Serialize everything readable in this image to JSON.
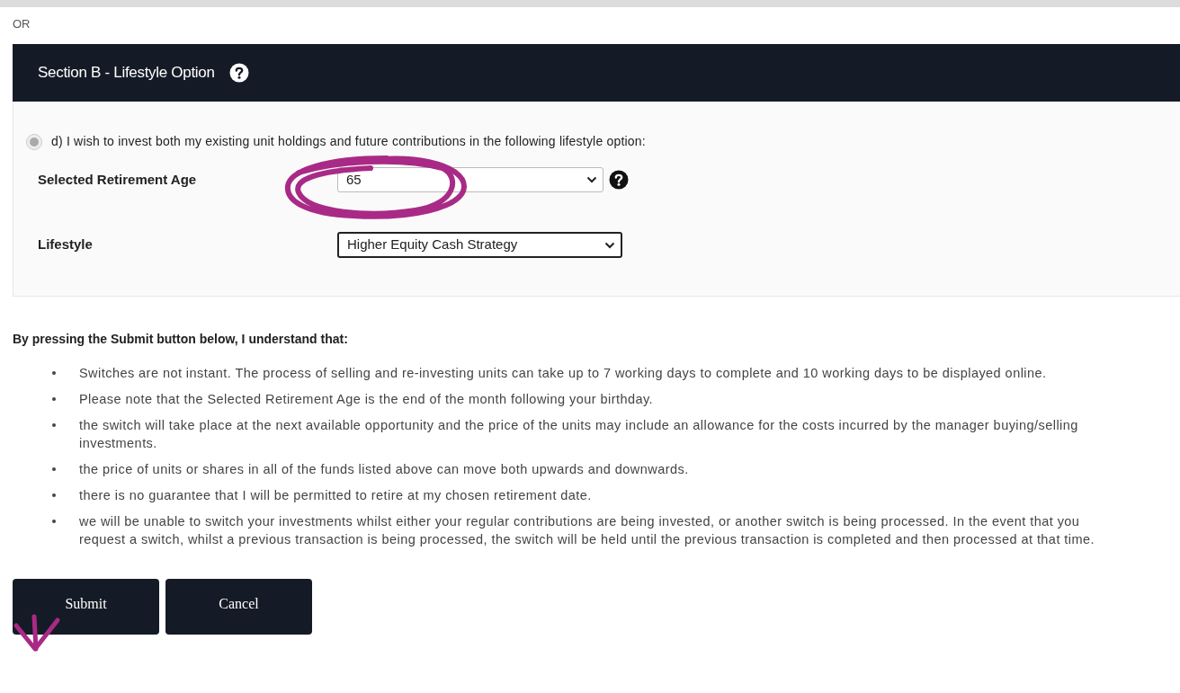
{
  "separator_label": "OR",
  "section": {
    "title": "Section B - Lifestyle Option",
    "option": {
      "label": "d) I wish to invest both my existing unit holdings and future contributions in the following lifestyle option:",
      "checked": true,
      "disabled": true
    },
    "fields": [
      {
        "label": "Selected Retirement Age",
        "value": "65",
        "help": true,
        "kind": "wide"
      },
      {
        "label": "Lifestyle",
        "value": "Higher Equity Cash Strategy",
        "help": false,
        "kind": "outlined"
      }
    ]
  },
  "terms": {
    "heading": "By pressing the Submit button below, I understand that:",
    "items": [
      "Switches are not instant. The process of selling and re-investing units can take up to 7 working days to complete and 10 working days to be displayed online.",
      "Please note that the Selected Retirement Age is the end of the month following your birthday.",
      "the switch will take place at the next available opportunity and the price of the units may include an allowance for the costs incurred by the manager buying/selling investments.",
      "the price of units or shares in all of the funds listed above can move both upwards and downwards.",
      "there is no guarantee that I will be permitted to retire at my chosen retirement date.",
      "we will be unable to switch your investments whilst either your regular contributions are being invested, or another switch is being processed. In the event that you request a switch, whilst a previous transaction is being processed, the switch will be held until the previous transaction is completed and then processed at that time."
    ]
  },
  "buttons": [
    "Submit",
    "Cancel"
  ]
}
